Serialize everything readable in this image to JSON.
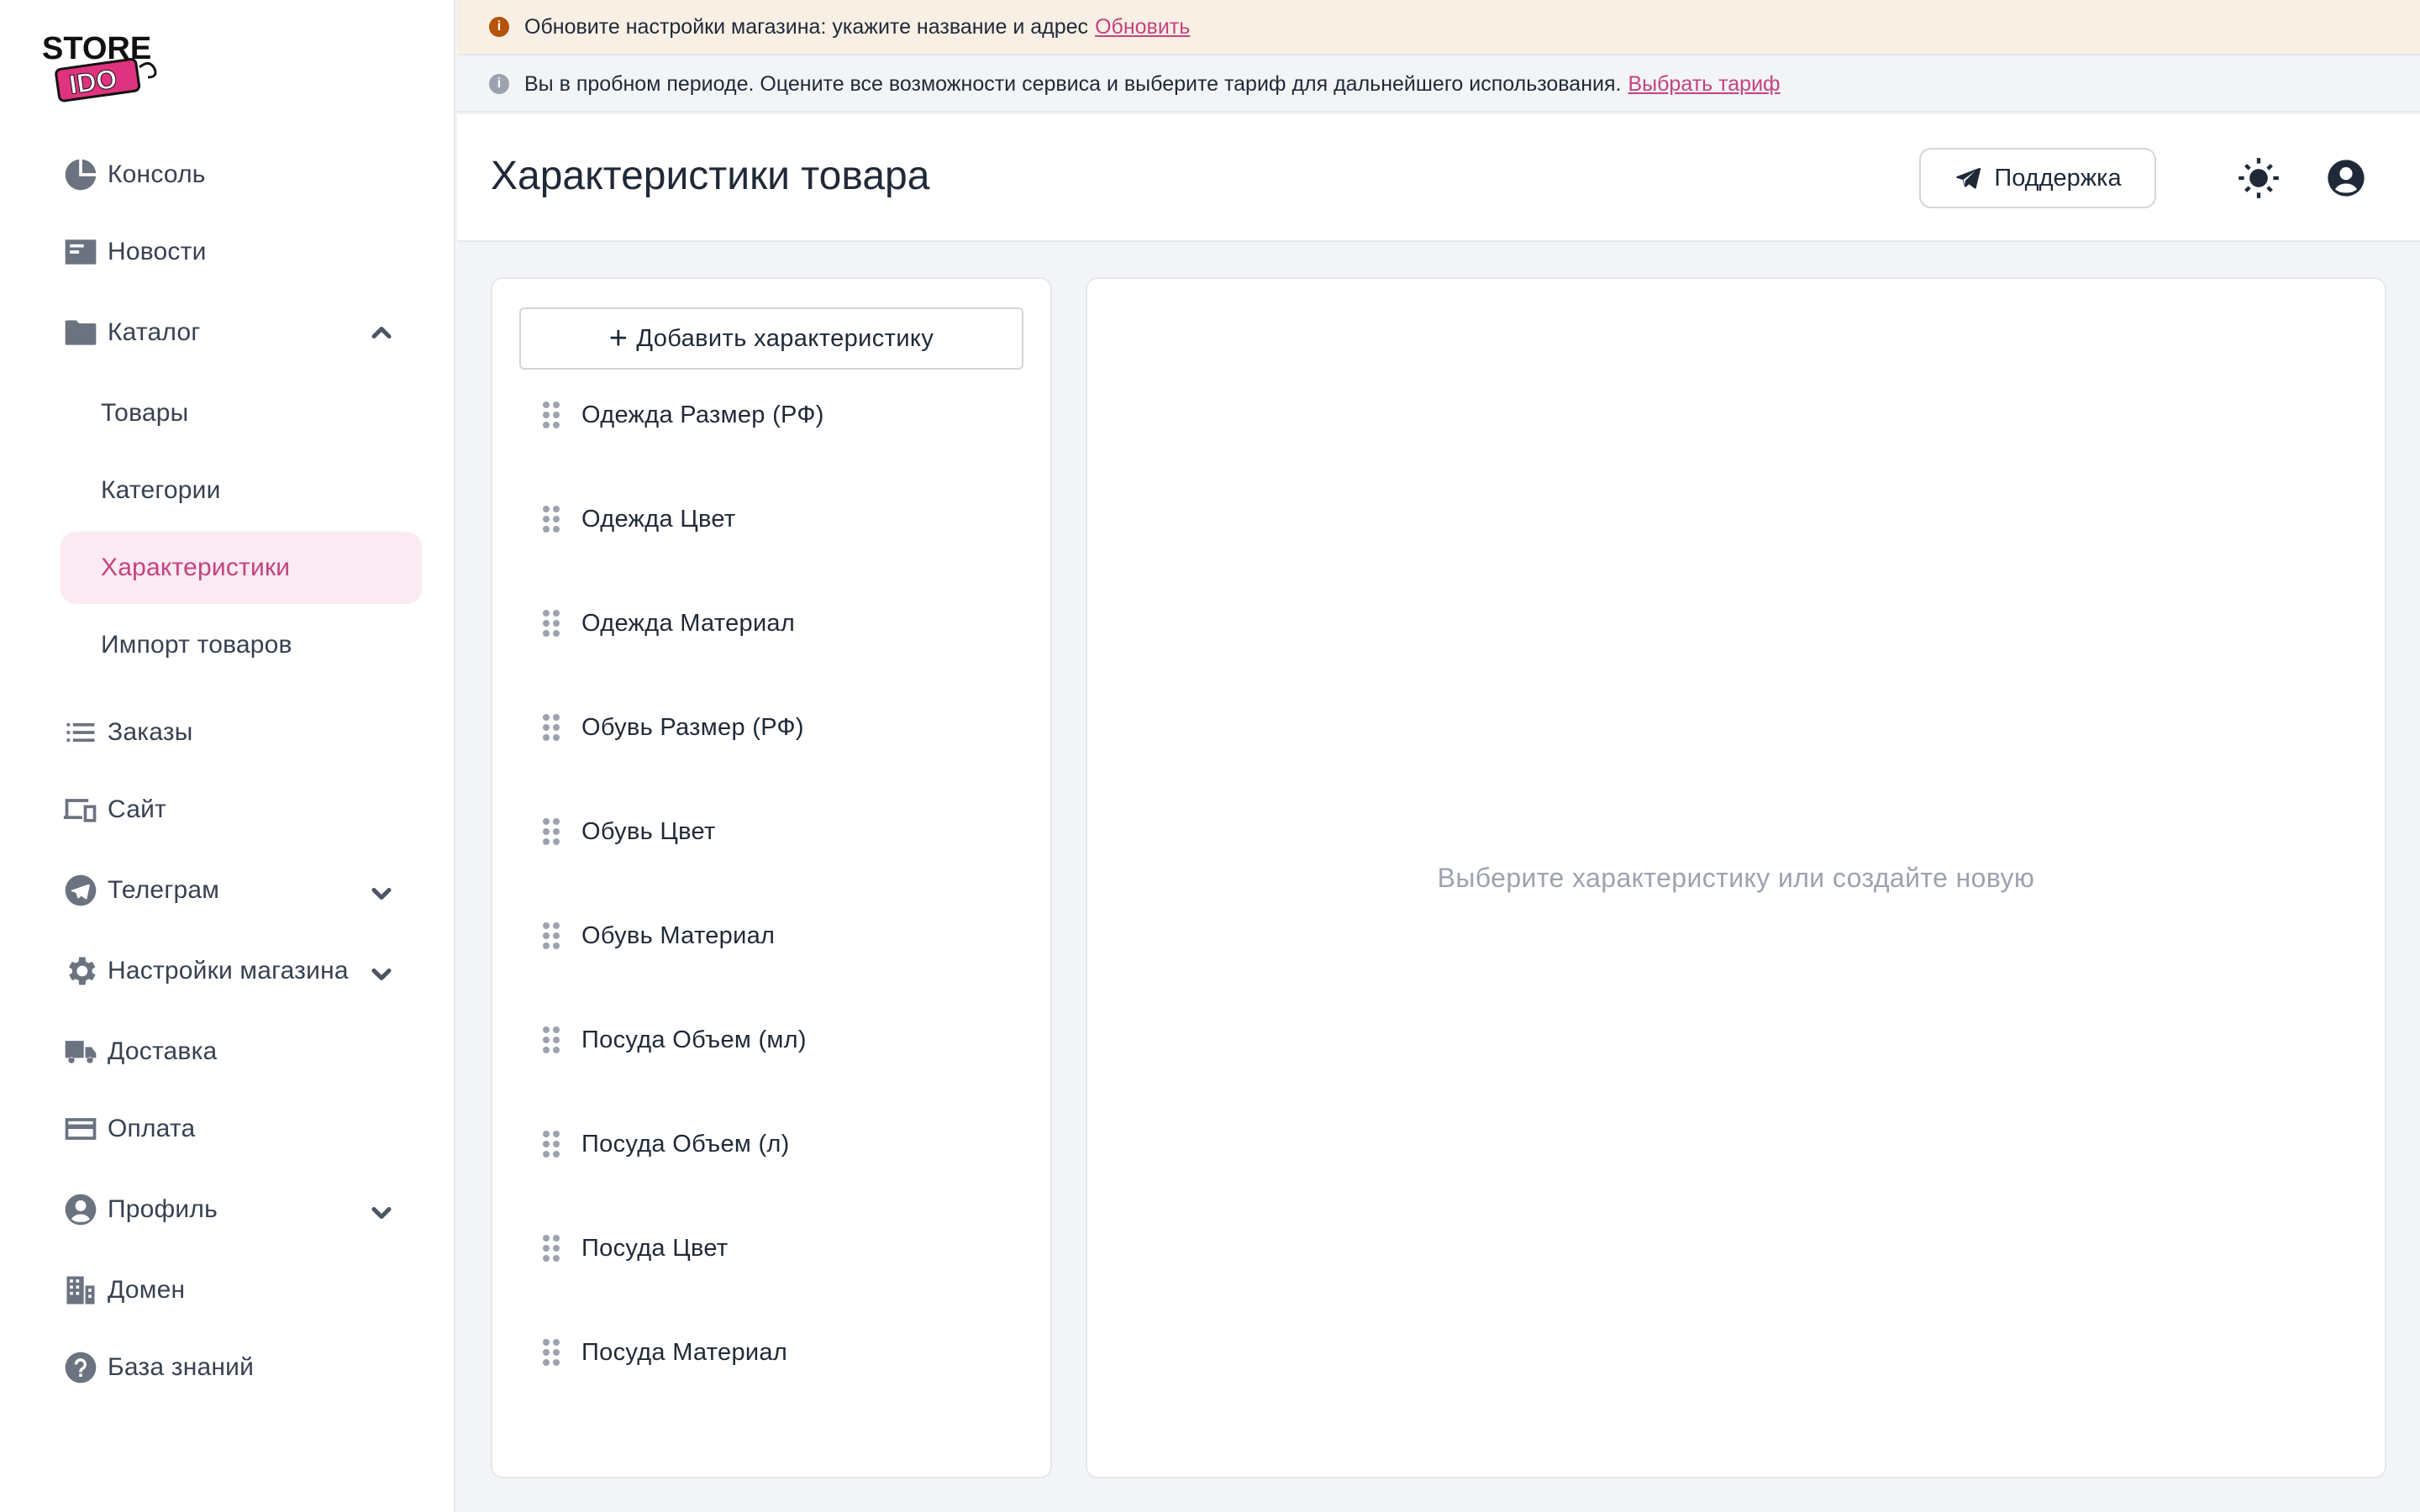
{
  "brand": {
    "logo_top": "STORE",
    "logo_bottom": "IDO",
    "accent": "#c4437e"
  },
  "banners": {
    "warning": {
      "text": "Обновите настройки магазина: укажите название и адрес",
      "link": "Обновить"
    },
    "info": {
      "text": "Вы в пробном периоде. Оцените все возможности сервиса и выберите тариф для дальнейшего использования.",
      "link": "Выбрать тариф"
    }
  },
  "sidebar": {
    "items": [
      {
        "label": "Консоль",
        "icon": "chart-pie-icon"
      },
      {
        "label": "Новости",
        "icon": "newspaper-icon"
      },
      {
        "label": "Каталог",
        "icon": "folder-icon",
        "expanded": true
      },
      {
        "label": "Заказы",
        "icon": "list-icon"
      },
      {
        "label": "Сайт",
        "icon": "devices-icon"
      },
      {
        "label": "Телеграм",
        "icon": "telegram-icon"
      },
      {
        "label": "Настройки магазина",
        "icon": "gear-icon"
      },
      {
        "label": "Доставка",
        "icon": "truck-icon"
      },
      {
        "label": "Оплата",
        "icon": "credit-card-icon"
      },
      {
        "label": "Профиль",
        "icon": "user-circle-icon"
      },
      {
        "label": "Домен",
        "icon": "building-icon"
      },
      {
        "label": "База знаний",
        "icon": "question-icon"
      }
    ],
    "catalog_sub": [
      {
        "label": "Товары"
      },
      {
        "label": "Категории"
      },
      {
        "label": "Характеристики",
        "active": true
      },
      {
        "label": "Импорт товаров"
      }
    ]
  },
  "header": {
    "title": "Характеристики товара",
    "support_label": "Поддержка",
    "theme_icon": "sun-icon",
    "account_icon": "user-circle-icon"
  },
  "attributes": {
    "add_label": "Добавить характеристику",
    "items": [
      "Одежда Размер (РФ)",
      "Одежда Цвет",
      "Одежда Материал",
      "Обувь Размер (РФ)",
      "Обувь Цвет",
      "Обувь Материал",
      "Посуда Объем (мл)",
      "Посуда Объем (л)",
      "Посуда Цвет",
      "Посуда Материал"
    ]
  },
  "detail": {
    "empty_text": "Выберите характеристику или создайте новую"
  }
}
